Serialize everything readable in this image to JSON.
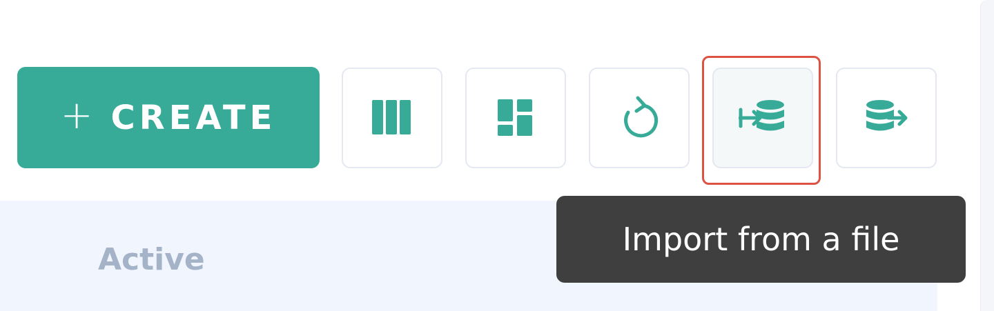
{
  "toolbar": {
    "create_button": {
      "icon": "plus-icon",
      "label": "CREATE"
    },
    "icon_buttons": [
      {
        "name": "columns-view",
        "icon": "columns-icon"
      },
      {
        "name": "dashboard-view",
        "icon": "dashboard-layout-icon"
      },
      {
        "name": "refresh",
        "icon": "refresh-icon"
      },
      {
        "name": "import-from-file",
        "icon": "database-import-icon",
        "state": "hovered"
      },
      {
        "name": "export",
        "icon": "database-export-icon"
      }
    ]
  },
  "tooltip": {
    "text": "Import from a file"
  },
  "tabs": [
    {
      "label": "Active"
    }
  ],
  "colors": {
    "accent": "#37ab97",
    "highlight_border": "#dc5344",
    "tooltip_bg": "#3f3f3f",
    "tab_inactive_text": "#a4b3c7",
    "panel_bg": "#f1f5fd"
  }
}
